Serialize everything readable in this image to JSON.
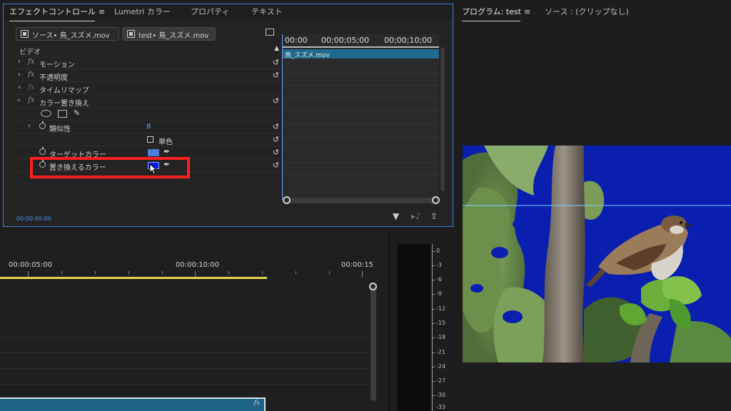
{
  "effect_panel": {
    "tabs": [
      {
        "label": "エフェクトコントロール"
      },
      {
        "label": "Lumetri カラー"
      },
      {
        "label": "プロパティ"
      },
      {
        "label": "テキスト"
      }
    ],
    "menu_icon": "≡",
    "clip_tabs": [
      {
        "label": "ソース• 鳥_スズメ.mov"
      },
      {
        "label": "test• 鳥_スズメ.mov"
      }
    ],
    "section_label": "ビデオ",
    "rows": {
      "motion": "モーション",
      "opacity": "不透明度",
      "time_remap": "タイムリマップ",
      "change_color": "カラー置き換え",
      "similarity_label": "類似性",
      "similarity_value": "8",
      "solid_color": "単色",
      "target_color": "ターゲットカラー",
      "replace_color": "置き換えるカラー"
    },
    "timeline": {
      "ruler_labels": [
        "00:00",
        "00;00;05;00",
        "00;00;10;00"
      ],
      "clip_label": "鳥_スズメ.mov"
    },
    "timecode": "00:00:00:00",
    "colors": {
      "accent_border": "#3d7fd1",
      "target_swatch": "#4d7fd6",
      "replace_swatch": "#0b1ad6",
      "highlight": "#ff1f1f"
    }
  },
  "program_monitor": {
    "tab_active": "プログラム: test",
    "tab_other": "ソース : (クリップなし)",
    "menu_icon": "≡"
  },
  "sequence": {
    "ruler_labels": [
      "00:00:05:00",
      "00:00:10:00",
      "00:00:15"
    ],
    "clip_fx": "fx"
  },
  "audio_meter": {
    "labels": [
      "0",
      "-3",
      "-6",
      "-9",
      "-12",
      "-15",
      "-18",
      "-21",
      "-24",
      "-27",
      "-30",
      "-33"
    ]
  }
}
